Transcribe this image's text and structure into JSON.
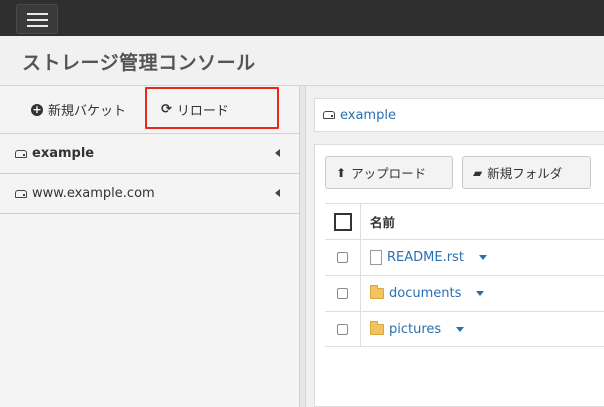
{
  "header": {
    "title": "ストレージ管理コンソール"
  },
  "sidebar": {
    "new_bucket_label": "新規バケット",
    "reload_label": "リロード",
    "buckets": [
      {
        "label": "example",
        "active": true
      },
      {
        "label": "www.example.com",
        "active": false
      }
    ]
  },
  "main": {
    "breadcrumb": "example",
    "toolbar": {
      "upload_label": "アップロード",
      "new_folder_label": "新規フォルダ"
    },
    "table": {
      "name_header": "名前",
      "rows": [
        {
          "name": "README.rst",
          "type": "file"
        },
        {
          "name": "documents",
          "type": "folder"
        },
        {
          "name": "pictures",
          "type": "folder"
        }
      ]
    }
  },
  "icons": {
    "menu": "hamburger-icon",
    "new": "plus-circle-icon",
    "reload": "refresh-icon",
    "bucket": "drive-icon",
    "upload": "upload-icon",
    "new_folder": "folder-open-icon",
    "file": "file-icon",
    "folder": "folder-icon",
    "row_menu": "caret-down-icon",
    "expand": "caret-left-icon"
  },
  "colors": {
    "link": "#2a6fb0",
    "highlight": "#e8291c",
    "topbar": "#2f2f2f"
  }
}
